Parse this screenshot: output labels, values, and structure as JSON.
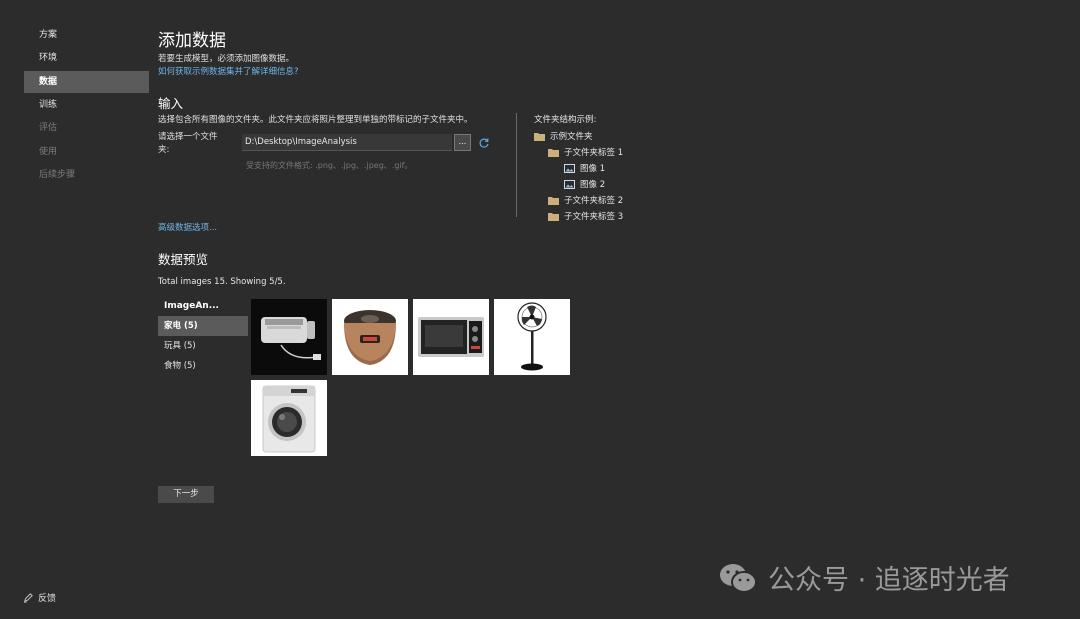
{
  "sidebar": {
    "items": [
      {
        "label": "方案"
      },
      {
        "label": "环境"
      },
      {
        "label": "数据"
      },
      {
        "label": "训练"
      },
      {
        "label": "评估"
      },
      {
        "label": "使用"
      },
      {
        "label": "后续步骤"
      }
    ],
    "active_index": 2,
    "feedback_label": "反馈"
  },
  "main": {
    "title": "添加数据",
    "subtitle": "若要生成模型，必须添加图像数据。",
    "help_link": "如何获取示例数据集并了解详细信息?",
    "input": {
      "heading": "输入",
      "description": "选择包含所有图像的文件夹。此文件夹应将照片整理到单独的带标记的子文件夹中。",
      "folder_label": "请选择一个文件夹:",
      "folder_path": "D:\\Desktop\\ImageAnalysis",
      "browse_label": "...",
      "formats_hint": "受支持的文件格式: .png、.jpg、.jpeg、.gif。"
    },
    "tree": {
      "title": "文件夹结构示例:",
      "root": "示例文件夹",
      "sub1": "子文件夹标签 1",
      "img1": "图像 1",
      "img2": "图像 2",
      "sub2": "子文件夹标签 2",
      "sub3": "子文件夹标签 3"
    },
    "advanced_link": "高级数据选项...",
    "preview": {
      "heading": "数据预览",
      "total_text": "Total images 15. Showing 5/5.",
      "root_folder": "ImageAn...",
      "categories": [
        {
          "label": "家电 (5)"
        },
        {
          "label": "玩具 (5)"
        },
        {
          "label": "食物 (5)"
        }
      ],
      "selected_category": 0,
      "thumbnails": [
        {
          "icon": "toaster-photo"
        },
        {
          "icon": "rice-cooker-photo"
        },
        {
          "icon": "oven-photo"
        },
        {
          "icon": "fan-photo"
        },
        {
          "icon": "washing-machine-photo"
        }
      ]
    },
    "next_label": "下一步"
  },
  "watermark": {
    "text": "公众号 · 追逐时光者"
  },
  "colors": {
    "background": "#2c2c2c",
    "sidebar_active": "#5b5b5b",
    "link": "#6fb6ea",
    "disabled": "#7d7d7d"
  }
}
